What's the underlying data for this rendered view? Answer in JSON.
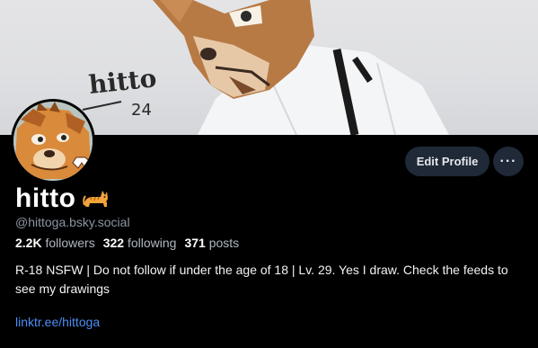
{
  "banner": {
    "signature_text": "hitto",
    "signature_number": "24"
  },
  "profile": {
    "display_name": "hitto",
    "emoji": "cat-emoji",
    "handle": "@hittoga.bsky.social",
    "followers_count": "2.2K",
    "followers_label": "followers",
    "following_count": "322",
    "following_label": "following",
    "posts_count": "371",
    "posts_label": "posts",
    "bio": "R-18 NSFW | Do not follow if under the age of 18 | Lv. 29. Yes I draw. Check the feeds to see my drawings",
    "link": "linktr.ee/hittoga"
  },
  "actions": {
    "edit_label": "Edit Profile",
    "more_label": "···"
  },
  "colors": {
    "background": "#000000",
    "button_bg": "#1f2937",
    "link": "#4d8ef5",
    "muted": "#8b95a3"
  }
}
